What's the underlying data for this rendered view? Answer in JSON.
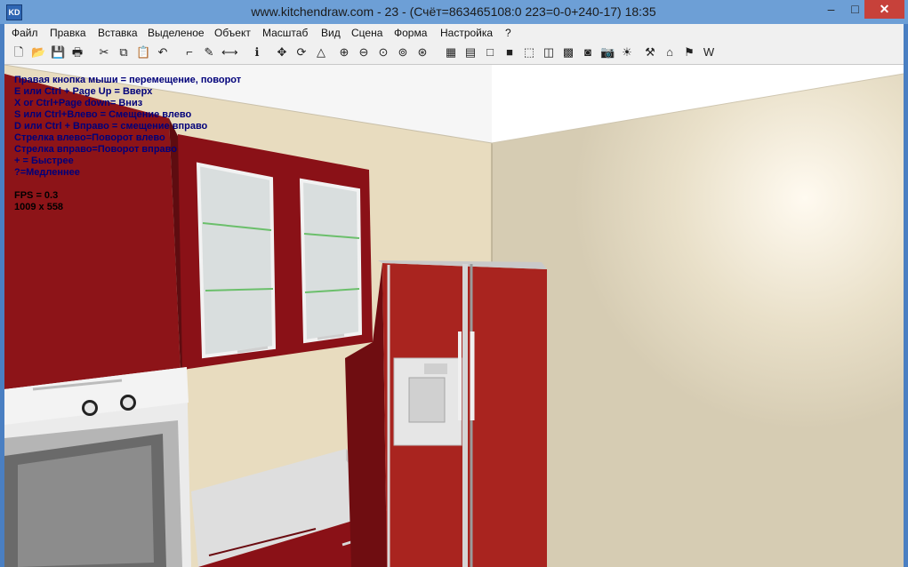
{
  "window": {
    "title": "www.kitchendraw.com - 23 - (Счёт=863465108:0 223=0-0+240-17) 18:35",
    "app_icon_text": "KD",
    "minimize_glyph": "–",
    "maximize_glyph": "□",
    "close_glyph": "✕"
  },
  "menu": [
    "Файл",
    "Правка",
    "Вставка",
    "Выделеное",
    "Объект",
    "Масштаб",
    "Вид",
    "Сцена",
    "Форма",
    "Настройка",
    "?"
  ],
  "toolbar": {
    "icons": [
      {
        "name": "new-file-icon",
        "glyph": "🗋"
      },
      {
        "name": "open-folder-icon",
        "glyph": "📂"
      },
      {
        "name": "save-icon",
        "glyph": "💾"
      },
      {
        "name": "print-icon",
        "glyph": "🖶"
      },
      {
        "name": "cut-icon",
        "glyph": "✂"
      },
      {
        "name": "copy-icon",
        "glyph": "⧉"
      },
      {
        "name": "paste-icon",
        "glyph": "📋"
      },
      {
        "name": "undo-icon",
        "glyph": "↶"
      },
      {
        "name": "stairs-icon",
        "glyph": "⌐"
      },
      {
        "name": "paint-icon",
        "glyph": "✎"
      },
      {
        "name": "dimension-icon",
        "glyph": "⟷"
      },
      {
        "name": "info-icon",
        "glyph": "ℹ"
      },
      {
        "name": "move-icon",
        "glyph": "✥"
      },
      {
        "name": "rotate-icon",
        "glyph": "⟳"
      },
      {
        "name": "perspective-icon",
        "glyph": "△"
      },
      {
        "name": "zoom-in-icon",
        "glyph": "⊕"
      },
      {
        "name": "zoom-out-icon",
        "glyph": "⊖"
      },
      {
        "name": "zoom-window-icon",
        "glyph": "⊙"
      },
      {
        "name": "zoom-fit-icon",
        "glyph": "⊚"
      },
      {
        "name": "zoom-all-icon",
        "glyph": "⊛"
      },
      {
        "name": "plan-view-icon",
        "glyph": "▦"
      },
      {
        "name": "elevation-view-icon",
        "glyph": "▤"
      },
      {
        "name": "wireframe-icon",
        "glyph": "□"
      },
      {
        "name": "solid-view-icon",
        "glyph": "■"
      },
      {
        "name": "box-3d-icon",
        "glyph": "⬚"
      },
      {
        "name": "cube-icon",
        "glyph": "◫"
      },
      {
        "name": "texture-icon",
        "glyph": "▩"
      },
      {
        "name": "render-icon",
        "glyph": "◙"
      },
      {
        "name": "camera-icon",
        "glyph": "📷"
      },
      {
        "name": "light-icon",
        "glyph": "☀"
      },
      {
        "name": "tools-icon",
        "glyph": "⚒"
      },
      {
        "name": "walls-icon",
        "glyph": "⌂"
      },
      {
        "name": "flag-icon",
        "glyph": "⚑"
      },
      {
        "name": "web-icon",
        "glyph": "W"
      }
    ]
  },
  "overlay": {
    "lines": [
      "Правая кнопка мыши = перемещение, поворот",
      "E или Ctrl + Page Up = Вверх",
      "X or Ctrl+Page down= Вниз",
      "S или Ctrl+Влево = Смещение влево",
      "D или Ctrl + Вправо = смещение вправо",
      "Стрелка влево=Поворот влево",
      "Стрелка вправо=Поворот вправо",
      "+ = Быстрее",
      "?=Медленнее"
    ],
    "fps": "FPS = 0.3",
    "resolution": "1009 x 558"
  },
  "colors": {
    "cabinet_red": "#8b1218",
    "fridge_red": "#a8241f",
    "wall_left": "#ece0c3",
    "wall_right": "#ddd3bb",
    "ceiling": "#ffffff",
    "countertop": "#e2e2e2"
  }
}
